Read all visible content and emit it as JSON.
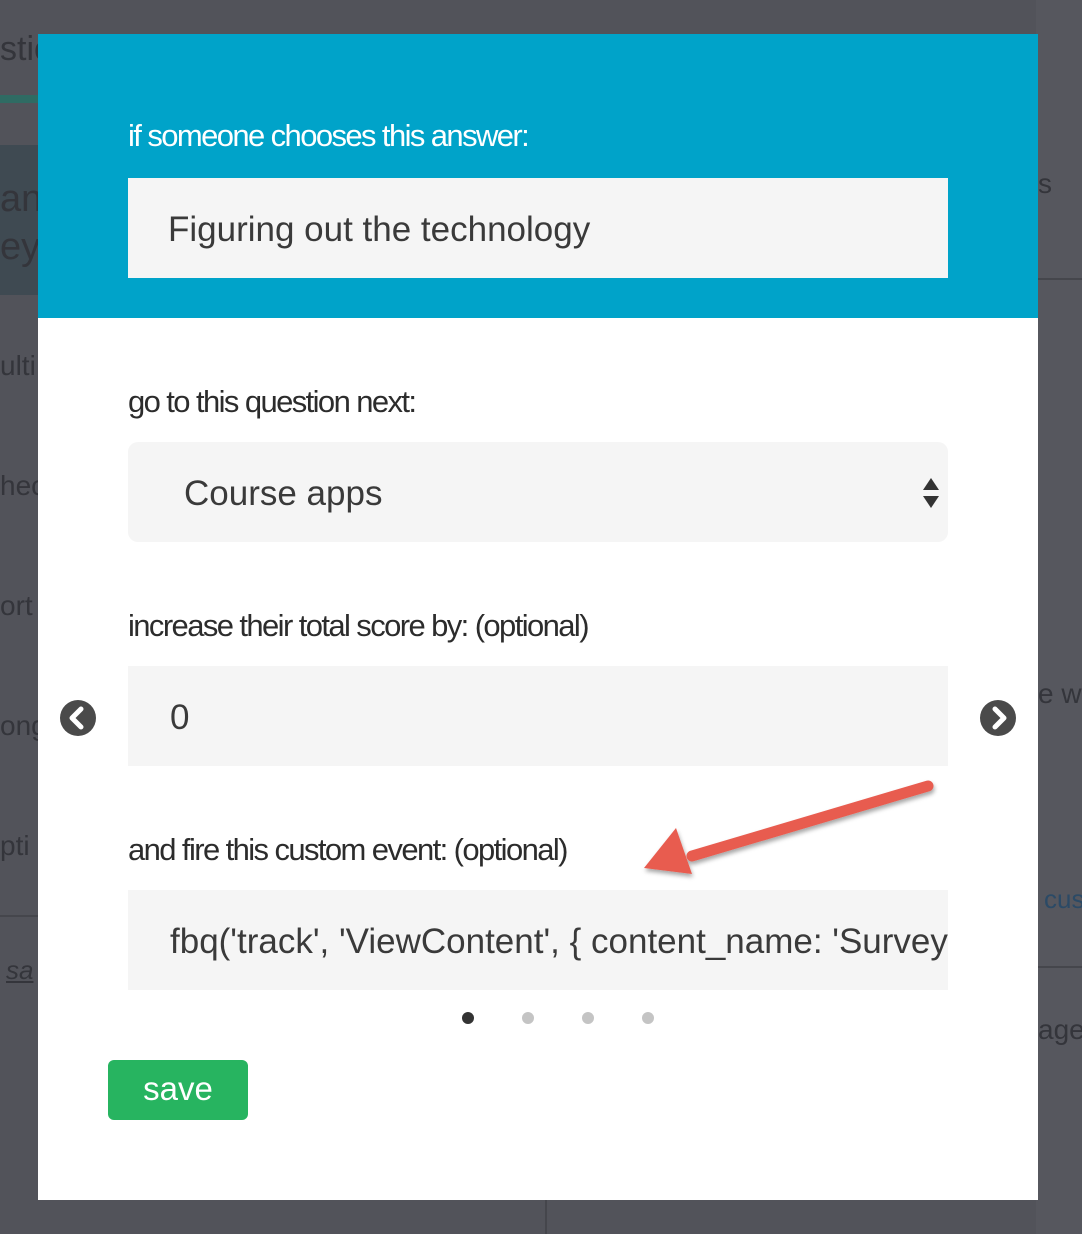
{
  "modal": {
    "answer_label": "if someone chooses this answer:",
    "answer_value": "Figuring out the technology",
    "next_question_label": "go to this question next:",
    "next_question_value": "Course apps",
    "score_label": "increase their total score by: (optional)",
    "score_value": "0",
    "event_label": "and fire this custom event: (optional)",
    "event_value": "fbq('track', 'ViewContent', { content_name: 'Survey'",
    "save_label": "save",
    "pagination": {
      "count": 4,
      "active": 1
    }
  },
  "background_fragments": {
    "top_left": "stio",
    "left_1": "an",
    "left_2": "ey",
    "left_3": "ulti",
    "left_4": "hec",
    "left_5": "ort",
    "left_6": "ong",
    "left_7": "pti",
    "left_8": "sa",
    "right_1": "s",
    "right_2": "e w",
    "right_3": "cus",
    "right_4": "age"
  },
  "colors": {
    "header": "#00a3c9",
    "save": "#27b460",
    "annotation_arrow": "#e85c50",
    "overlay": "#4d4e55"
  },
  "icons": {
    "prev": "chevron-left-circle-icon",
    "next": "chevron-right-circle-icon",
    "select": "select-updown-icon",
    "annotation": "red-arrow-annotation"
  }
}
